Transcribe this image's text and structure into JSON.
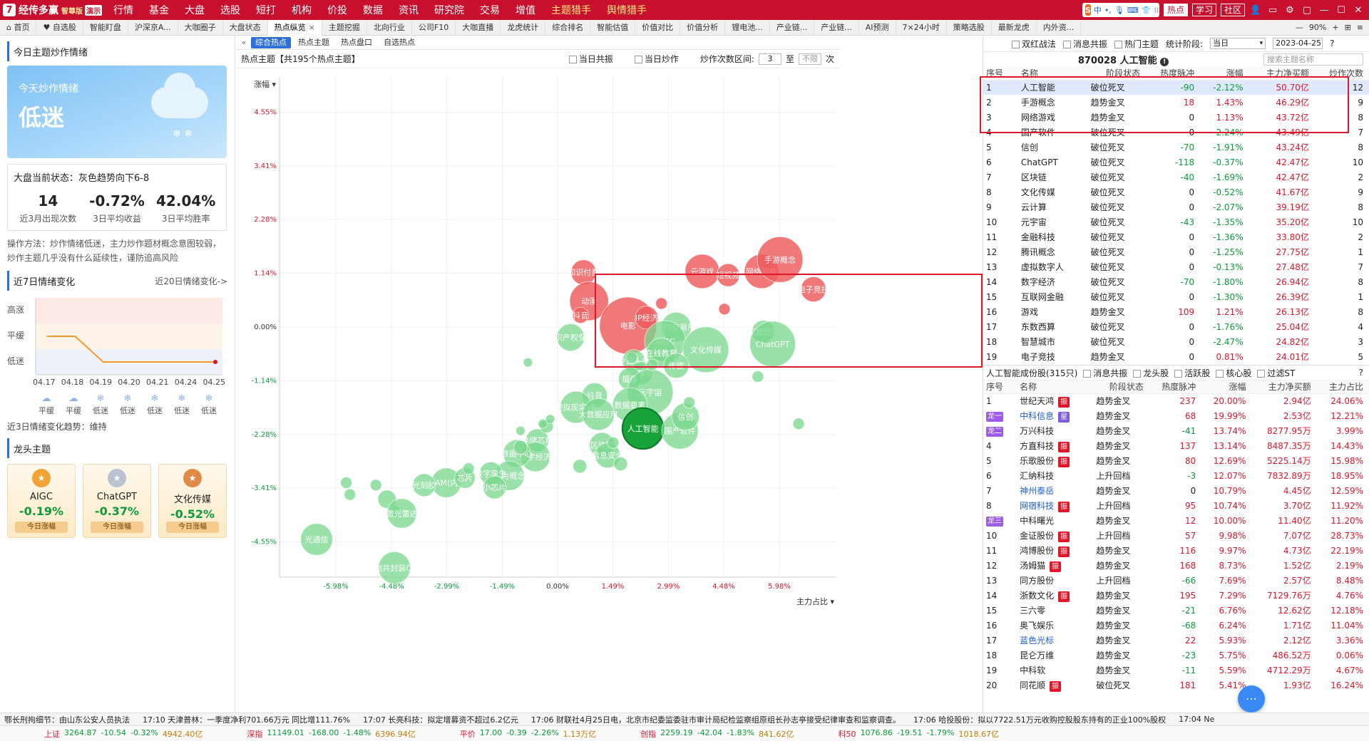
{
  "app": {
    "logo_letter": "7",
    "name": "经传多赢",
    "edition": "智尊版",
    "version": "演示"
  },
  "menu": [
    {
      "label": "行情",
      "dot": false
    },
    {
      "label": "基金",
      "dot": false
    },
    {
      "label": "大盘",
      "dot": true
    },
    {
      "label": "选股",
      "dot": true
    },
    {
      "label": "短打",
      "dot": false
    },
    {
      "label": "机构",
      "dot": false
    },
    {
      "label": "价投",
      "dot": false
    },
    {
      "label": "数据",
      "dot": false
    },
    {
      "label": "资讯",
      "dot": false
    },
    {
      "label": "研究院",
      "dot": true
    },
    {
      "label": "交易",
      "dot": false
    },
    {
      "label": "增值",
      "dot": true
    },
    {
      "label": "主题猎手",
      "hl": true
    },
    {
      "label": "舆情猎手",
      "hl": true
    }
  ],
  "topright": {
    "ime": "中",
    "buttons": [
      "热点",
      "学习",
      "社区"
    ]
  },
  "tabs": [
    {
      "label": "首页",
      "icon": "home-icon"
    },
    {
      "label": "自选股",
      "icon": "heart-icon"
    },
    {
      "label": "智能盯盘"
    },
    {
      "label": "沪深京A..."
    },
    {
      "label": "大咖圈子"
    },
    {
      "label": "大盘状态"
    },
    {
      "label": "热点纵览",
      "active": true,
      "closable": true
    },
    {
      "label": "主题挖掘"
    },
    {
      "label": "北向行业"
    },
    {
      "label": "公司F10"
    },
    {
      "label": "大咖直播"
    },
    {
      "label": "龙虎统计"
    },
    {
      "label": "综合排名"
    },
    {
      "label": "智能估值"
    },
    {
      "label": "价值对比"
    },
    {
      "label": "价值分析"
    },
    {
      "label": "锂电池..."
    },
    {
      "label": "产业链..."
    },
    {
      "label": "产业链..."
    },
    {
      "label": "AI预测"
    },
    {
      "label": "7×24小时"
    },
    {
      "label": "策略选股"
    },
    {
      "label": "最新龙虎"
    },
    {
      "label": "内外资..."
    }
  ],
  "zoom": "90%",
  "left": {
    "mood_title": "今日主题炒作情绪",
    "mood_card_label": "今天炒作情绪",
    "mood_value": "低迷",
    "market_state": "大盘当前状态：灰色趋势向下6-8",
    "stats": [
      {
        "value": "14",
        "desc": "近3月出现次数"
      },
      {
        "value": "-0.72%",
        "desc": "3日平均收益"
      },
      {
        "value": "42.04%",
        "desc": "3日平均胜率"
      }
    ],
    "method": "操作方法：炒作情绪低迷，主力炒作题材概念意图较弱，炒作主题几乎没有什么延续性，谨防追高风险",
    "week_title": "近7日情绪变化",
    "week_more": "近20日情绪变化->",
    "levels": [
      "高涨",
      "平缓",
      "低迷"
    ],
    "dates": [
      "04.17",
      "04.18",
      "04.19",
      "04.20",
      "04.21",
      "04.24",
      "04.25"
    ],
    "day_moods": [
      "平缓",
      "平缓",
      "低迷",
      "低迷",
      "低迷",
      "低迷",
      "低迷"
    ],
    "trend": "近3日情绪变化趋势：维持",
    "leaders_title": "龙头主题",
    "leaders": [
      {
        "name": "AIGC",
        "pct": "-0.19%",
        "btn": "今日涨幅",
        "medal": "gold"
      },
      {
        "name": "ChatGPT",
        "pct": "-0.37%",
        "btn": "今日涨幅",
        "medal": "silver"
      },
      {
        "name": "文化传媒",
        "pct": "-0.52%",
        "btn": "今日涨幅",
        "medal": "bronze"
      }
    ]
  },
  "center": {
    "subtabs": [
      "综合热点",
      "热点主题",
      "热点盘口",
      "自选热点"
    ],
    "title": "热点主题【共195个热点主题】",
    "opt_resonance": "当日共振",
    "opt_hype": "当日炒作",
    "range_label": "炒作次数区间:",
    "range_from": "3",
    "range_to_label": "至",
    "range_to": "不限",
    "range_unit": "次",
    "ylabel": "涨幅",
    "xlabel": "主力占比"
  },
  "chart_data": {
    "type": "scatter",
    "xlabel": "主力占比",
    "ylabel": "涨幅",
    "x_ticks": [
      "-5.98%",
      "-4.48%",
      "-2.99%",
      "-1.49%",
      "0.00%",
      "1.49%",
      "2.99%",
      "4.48%",
      "5.98%"
    ],
    "y_ticks": [
      "4.55%",
      "3.41%",
      "2.28%",
      "1.14%",
      "0.00%",
      "-1.14%",
      "-2.28%",
      "-3.41%",
      "-4.55%"
    ],
    "xlim": [
      -7.5,
      7.5
    ],
    "ylim": [
      -5.3,
      5.3
    ],
    "points": [
      {
        "x": 0.7,
        "y": 1.16,
        "r": 1.1,
        "label": "知识付费"
      },
      {
        "x": 0.85,
        "y": 0.55,
        "r": 1.7,
        "label": "动漫"
      },
      {
        "x": 0.62,
        "y": 0.25,
        "r": 0.7,
        "label": "抖音"
      },
      {
        "x": 1.9,
        "y": 0.03,
        "r": 2.5,
        "label": "电影"
      },
      {
        "x": 2.4,
        "y": 0.2,
        "r": 1.0,
        "label": "IP经济"
      },
      {
        "x": 2.8,
        "y": 0.5,
        "r": 0.5,
        "label": ""
      },
      {
        "x": 3.9,
        "y": 1.18,
        "r": 1.5,
        "label": "云游戏"
      },
      {
        "x": 4.6,
        "y": 1.1,
        "r": 1.0,
        "label": "短视频"
      },
      {
        "x": 5.5,
        "y": 1.18,
        "r": 1.5,
        "label": "网络游戏"
      },
      {
        "x": 6.0,
        "y": 1.43,
        "r": 2.0,
        "label": "手游概念"
      },
      {
        "x": 6.9,
        "y": 0.8,
        "r": 1.1,
        "label": "电子竞技"
      },
      {
        "x": 4.5,
        "y": 0.38,
        "r": 0.5,
        "label": ""
      },
      {
        "x": 3.2,
        "y": 0.0,
        "r": 1.3,
        "label": "NFT交易所"
      },
      {
        "x": 2.9,
        "y": -0.3,
        "r": 1.8,
        "label": "AIGC"
      },
      {
        "x": 2.8,
        "y": -0.55,
        "r": 1.3,
        "label": "在线教育"
      },
      {
        "x": 0.35,
        "y": -0.22,
        "r": 1.2,
        "label": "知识产权保护"
      },
      {
        "x": 5.55,
        "y": -0.1,
        "r": 1.0,
        "label": "东数西算"
      },
      {
        "x": 5.8,
        "y": -0.36,
        "r": 2.0,
        "label": "ChatGPT"
      },
      {
        "x": 4.0,
        "y": -0.48,
        "r": 2.0,
        "label": "文化传媒"
      },
      {
        "x": 3.2,
        "y": -0.82,
        "r": 1.1,
        "label": "传媒"
      },
      {
        "x": 2.05,
        "y": -0.72,
        "r": 1.0,
        "label": "今日头条"
      },
      {
        "x": 2.25,
        "y": -0.98,
        "r": 1.0,
        "label": "虚拟数字人"
      },
      {
        "x": 1.95,
        "y": -1.1,
        "r": 1.0,
        "label": "摄像"
      },
      {
        "x": 2.5,
        "y": -1.38,
        "r": 2.0,
        "label": "元宇宙"
      },
      {
        "x": 1.95,
        "y": -1.65,
        "r": 1.5,
        "label": "数据要素"
      },
      {
        "x": 1.0,
        "y": -1.45,
        "r": 1.1,
        "label": "抖音"
      },
      {
        "x": 0.5,
        "y": -1.7,
        "r": 1.4,
        "label": "虚拟现实VR"
      },
      {
        "x": 1.1,
        "y": -1.85,
        "r": 1.4,
        "label": "大数据应用"
      },
      {
        "x": 2.3,
        "y": -2.15,
        "r": 1.8,
        "label": "人工智能",
        "highlight": true
      },
      {
        "x": 3.3,
        "y": -2.2,
        "r": 1.6,
        "label": "国产软件"
      },
      {
        "x": 3.45,
        "y": -1.9,
        "r": 1.2,
        "label": "信创"
      },
      {
        "x": 1.2,
        "y": -2.5,
        "r": 1.1,
        "label": "区块链"
      },
      {
        "x": 1.35,
        "y": -2.72,
        "r": 1.1,
        "label": "信息安全"
      },
      {
        "x": -0.55,
        "y": -2.4,
        "r": 1.0,
        "label": "存储芯片"
      },
      {
        "x": -0.6,
        "y": -2.75,
        "r": 1.3,
        "label": "数字经济"
      },
      {
        "x": -1.1,
        "y": -2.68,
        "r": 1.2,
        "label": "数据中心"
      },
      {
        "x": -1.3,
        "y": -3.15,
        "r": 1.3,
        "label": "华为概念"
      },
      {
        "x": -1.8,
        "y": -3.1,
        "r": 1.0,
        "label": "数字孪生"
      },
      {
        "x": -3.0,
        "y": -3.3,
        "r": 1.3,
        "label": "DRAM(内存)"
      },
      {
        "x": -2.5,
        "y": -3.2,
        "r": 0.9,
        "label": "芯片"
      },
      {
        "x": -1.7,
        "y": -3.4,
        "r": 1.0,
        "label": "小芯片"
      },
      {
        "x": -3.6,
        "y": -3.35,
        "r": 1.0,
        "label": "光刻胶"
      },
      {
        "x": 0.6,
        "y": -2.95,
        "r": 0.6,
        "label": ""
      },
      {
        "x": 1.7,
        "y": -2.9,
        "r": 0.6,
        "label": ""
      },
      {
        "x": -0.3,
        "y": -2.1,
        "r": 0.6,
        "label": ""
      },
      {
        "x": -1.0,
        "y": -2.55,
        "r": 0.6,
        "label": ""
      },
      {
        "x": -2.4,
        "y": -3.0,
        "r": 0.5,
        "label": ""
      },
      {
        "x": -1.0,
        "y": -2.2,
        "r": 0.4,
        "label": ""
      },
      {
        "x": -0.8,
        "y": -0.75,
        "r": 0.4,
        "label": ""
      },
      {
        "x": -0.2,
        "y": -1.95,
        "r": 0.4,
        "label": ""
      },
      {
        "x": -0.4,
        "y": -2.05,
        "r": 0.4,
        "label": ""
      },
      {
        "x": 5.4,
        "y": -1.05,
        "r": 0.5,
        "label": ""
      },
      {
        "x": 6.5,
        "y": -2.05,
        "r": 0.5,
        "label": ""
      },
      {
        "x": 2.55,
        "y": -0.8,
        "r": 0.5,
        "label": ""
      },
      {
        "x": 1.5,
        "y": -2.45,
        "r": 0.5,
        "label": ""
      },
      {
        "x": 2.0,
        "y": -0.65,
        "r": 0.5,
        "label": ""
      },
      {
        "x": 3.55,
        "y": -1.6,
        "r": 0.5,
        "label": ""
      },
      {
        "x": -5.6,
        "y": -3.55,
        "r": 0.5,
        "label": ""
      },
      {
        "x": -4.9,
        "y": -3.35,
        "r": 0.5,
        "label": ""
      },
      {
        "x": -4.4,
        "y": -3.9,
        "r": 0.5,
        "label": ""
      },
      {
        "x": -4.6,
        "y": -3.65,
        "r": 0.8,
        "label": ""
      },
      {
        "x": -4.2,
        "y": -3.95,
        "r": 1.3,
        "label": "激光雷达"
      },
      {
        "x": -6.5,
        "y": -4.5,
        "r": 1.4,
        "label": "光通信"
      },
      {
        "x": -4.4,
        "y": -5.1,
        "r": 1.4,
        "label": "光电共封装CPO"
      },
      {
        "x": -5.7,
        "y": -3.3,
        "r": 0.5,
        "label": ""
      }
    ]
  },
  "right": {
    "filters": [
      "双红战法",
      "消息共振",
      "热门主题"
    ],
    "stat_period_label": "统计阶段:",
    "stat_period": "当日",
    "date": "2023-04-25",
    "code_title": "870028 人工智能",
    "search_placeholder": "搜索主题名称",
    "theme_cols": [
      "序号",
      "名称",
      "阶段状态",
      "热度脉冲",
      "涨幅",
      "主力净买额",
      "炒作次数"
    ],
    "themes": [
      [
        "1",
        "人工智能",
        "破位死叉",
        "-90",
        "-2.12%",
        "50.70亿",
        "12"
      ],
      [
        "2",
        "手游概念",
        "趋势金叉",
        "18",
        "1.43%",
        "46.29亿",
        "9"
      ],
      [
        "3",
        "网络游戏",
        "趋势金叉",
        "0",
        "1.13%",
        "43.72亿",
        "8"
      ],
      [
        "4",
        "国产软件",
        "破位死叉",
        "0",
        "-2.24%",
        "43.49亿",
        "7"
      ],
      [
        "5",
        "信创",
        "破位死叉",
        "-70",
        "-1.91%",
        "43.24亿",
        "8"
      ],
      [
        "6",
        "ChatGPT",
        "破位死叉",
        "-118",
        "-0.37%",
        "42.47亿",
        "10"
      ],
      [
        "7",
        "区块链",
        "破位死叉",
        "-40",
        "-1.69%",
        "42.47亿",
        "2"
      ],
      [
        "8",
        "文化传媒",
        "破位死叉",
        "0",
        "-0.52%",
        "41.67亿",
        "9"
      ],
      [
        "9",
        "云计算",
        "破位死叉",
        "0",
        "-2.07%",
        "39.19亿",
        "8"
      ],
      [
        "10",
        "元宇宙",
        "破位死叉",
        "-43",
        "-1.35%",
        "35.20亿",
        "10"
      ],
      [
        "11",
        "金融科技",
        "破位死叉",
        "0",
        "-1.36%",
        "33.80亿",
        "2"
      ],
      [
        "12",
        "腾讯概念",
        "破位死叉",
        "0",
        "-1.25%",
        "27.75亿",
        "1"
      ],
      [
        "13",
        "虚拟数字人",
        "破位死叉",
        "0",
        "-0.13%",
        "27.48亿",
        "7"
      ],
      [
        "14",
        "数字经济",
        "破位死叉",
        "-70",
        "-1.80%",
        "26.94亿",
        "8"
      ],
      [
        "15",
        "互联网金融",
        "破位死叉",
        "0",
        "-1.30%",
        "26.39亿",
        "1"
      ],
      [
        "16",
        "游戏",
        "趋势金叉",
        "109",
        "1.21%",
        "26.13亿",
        "8"
      ],
      [
        "17",
        "东数西算",
        "破位死叉",
        "0",
        "-1.76%",
        "25.04亿",
        "4"
      ],
      [
        "18",
        "智慧城市",
        "破位死叉",
        "0",
        "-2.47%",
        "24.82亿",
        "3"
      ],
      [
        "19",
        "电子竞技",
        "趋势金叉",
        "0",
        "0.81%",
        "24.01亿",
        "5"
      ]
    ],
    "stock_title": "人工智能成份股(315只)",
    "stock_filters": [
      "消息共振",
      "龙头股",
      "活跃股",
      "核心股",
      "过滤ST"
    ],
    "stock_cols": [
      "序号",
      "名称",
      "阶段状态",
      "热度脉冲",
      "涨幅",
      "主力净买额",
      "主力占比"
    ],
    "stocks": [
      {
        "no": "1",
        "name": "世纪天鸿",
        "tag": "振",
        "stage": "趋势金叉",
        "heat": "237",
        "chg": "20.00%",
        "net": "2.94亿",
        "ratio": "24.06%"
      },
      {
        "no": "龙一",
        "name": "中科信息",
        "tag": "星",
        "stage": "趋势金叉",
        "heat": "68",
        "chg": "19.99%",
        "net": "2.53亿",
        "ratio": "12.21%",
        "blue": true
      },
      {
        "no": "龙二",
        "name": "万兴科技",
        "tag": "",
        "stage": "趋势金叉",
        "heat": "-41",
        "chg": "13.74%",
        "net": "8277.95万",
        "ratio": "3.99%"
      },
      {
        "no": "4",
        "name": "方直科技",
        "tag": "振",
        "stage": "趋势金叉",
        "heat": "137",
        "chg": "13.14%",
        "net": "8487.35万",
        "ratio": "14.43%"
      },
      {
        "no": "5",
        "name": "乐歌股份",
        "tag": "振",
        "stage": "趋势金叉",
        "heat": "80",
        "chg": "12.69%",
        "net": "5225.14万",
        "ratio": "15.98%"
      },
      {
        "no": "6",
        "name": "汇纳科技",
        "tag": "",
        "stage": "上升回档",
        "heat": "-3",
        "chg": "12.07%",
        "net": "7832.89万",
        "ratio": "18.95%"
      },
      {
        "no": "7",
        "name": "神州泰岳",
        "tag": "",
        "stage": "趋势金叉",
        "heat": "0",
        "chg": "10.79%",
        "net": "4.45亿",
        "ratio": "12.59%",
        "blue": true
      },
      {
        "no": "8",
        "name": "网宿科技",
        "tag": "振",
        "stage": "上升回档",
        "heat": "95",
        "chg": "10.74%",
        "net": "3.70亿",
        "ratio": "11.92%",
        "blue": true
      },
      {
        "no": "龙三",
        "name": "中科曙光",
        "tag": "",
        "stage": "趋势金叉",
        "heat": "12",
        "chg": "10.00%",
        "net": "11.40亿",
        "ratio": "11.20%"
      },
      {
        "no": "10",
        "name": "金证股份",
        "tag": "振",
        "stage": "上升回档",
        "heat": "57",
        "chg": "9.98%",
        "net": "7.07亿",
        "ratio": "28.73%"
      },
      {
        "no": "11",
        "name": "鸿博股份",
        "tag": "振",
        "stage": "趋势金叉",
        "heat": "116",
        "chg": "9.97%",
        "net": "4.73亿",
        "ratio": "22.19%"
      },
      {
        "no": "12",
        "name": "汤姆猫",
        "tag": "振",
        "stage": "趋势金叉",
        "heat": "168",
        "chg": "8.73%",
        "net": "1.52亿",
        "ratio": "2.19%"
      },
      {
        "no": "13",
        "name": "同方股份",
        "tag": "",
        "stage": "上升回档",
        "heat": "-66",
        "chg": "7.69%",
        "net": "2.57亿",
        "ratio": "8.48%"
      },
      {
        "no": "14",
        "name": "浙数文化",
        "tag": "振",
        "stage": "趋势金叉",
        "heat": "195",
        "chg": "7.29%",
        "net": "7129.76万",
        "ratio": "4.76%"
      },
      {
        "no": "15",
        "name": "三六零",
        "tag": "",
        "stage": "趋势金叉",
        "heat": "-21",
        "chg": "6.76%",
        "net": "12.62亿",
        "ratio": "12.18%"
      },
      {
        "no": "16",
        "name": "奥飞娱乐",
        "tag": "",
        "stage": "趋势金叉",
        "heat": "-68",
        "chg": "6.24%",
        "net": "1.71亿",
        "ratio": "11.04%"
      },
      {
        "no": "17",
        "name": "蓝色光标",
        "tag": "",
        "stage": "趋势金叉",
        "heat": "22",
        "chg": "5.93%",
        "net": "2.12亿",
        "ratio": "3.36%",
        "blue": true
      },
      {
        "no": "18",
        "name": "昆仑万维",
        "tag": "",
        "stage": "趋势金叉",
        "heat": "-23",
        "chg": "5.75%",
        "net": "486.52万",
        "ratio": "0.06%"
      },
      {
        "no": "19",
        "name": "中科软",
        "tag": "",
        "stage": "趋势金叉",
        "heat": "-11",
        "chg": "5.59%",
        "net": "4712.29万",
        "ratio": "4.67%"
      },
      {
        "no": "20",
        "name": "同花顺",
        "tag": "振",
        "stage": "破位死叉",
        "heat": "181",
        "chg": "5.41%",
        "net": "1.93亿",
        "ratio": "16.24%"
      }
    ]
  },
  "news": [
    "鄂长刑拘细节：由山东公安人员执法",
    "17:10 天津普林：一季度净利701.66万元 同比增111.76%",
    "17:07 长亮科技：拟定增募资不超过6.2亿元",
    "17:06 财联社4月25日电，北京市纪委监委驻市审计局纪检监察组原组长孙志亭接受纪律审查和监察调查。",
    "17:06 哈投股份：拟以7722.51万元收购控股股东持有的正业100%股权",
    "17:04 Ne"
  ],
  "indices": [
    {
      "name": "上证",
      "val": "3264.87",
      "chg": "-10.54",
      "pct": "-0.32%",
      "amt": "4942.40亿"
    },
    {
      "name": "深指",
      "val": "11149.01",
      "chg": "-168.00",
      "pct": "-1.48%",
      "amt": "6396.94亿"
    },
    {
      "name": "平价",
      "val": "17.00",
      "chg": "-0.39",
      "pct": "-2.26%",
      "amt": "1.13万亿"
    },
    {
      "name": "创指",
      "val": "2259.19",
      "chg": "-42.04",
      "pct": "-1.83%",
      "amt": "841.62亿"
    },
    {
      "name": "科50",
      "val": "1076.86",
      "chg": "-19.51",
      "pct": "-1.79%",
      "amt": "1018.67亿"
    }
  ]
}
